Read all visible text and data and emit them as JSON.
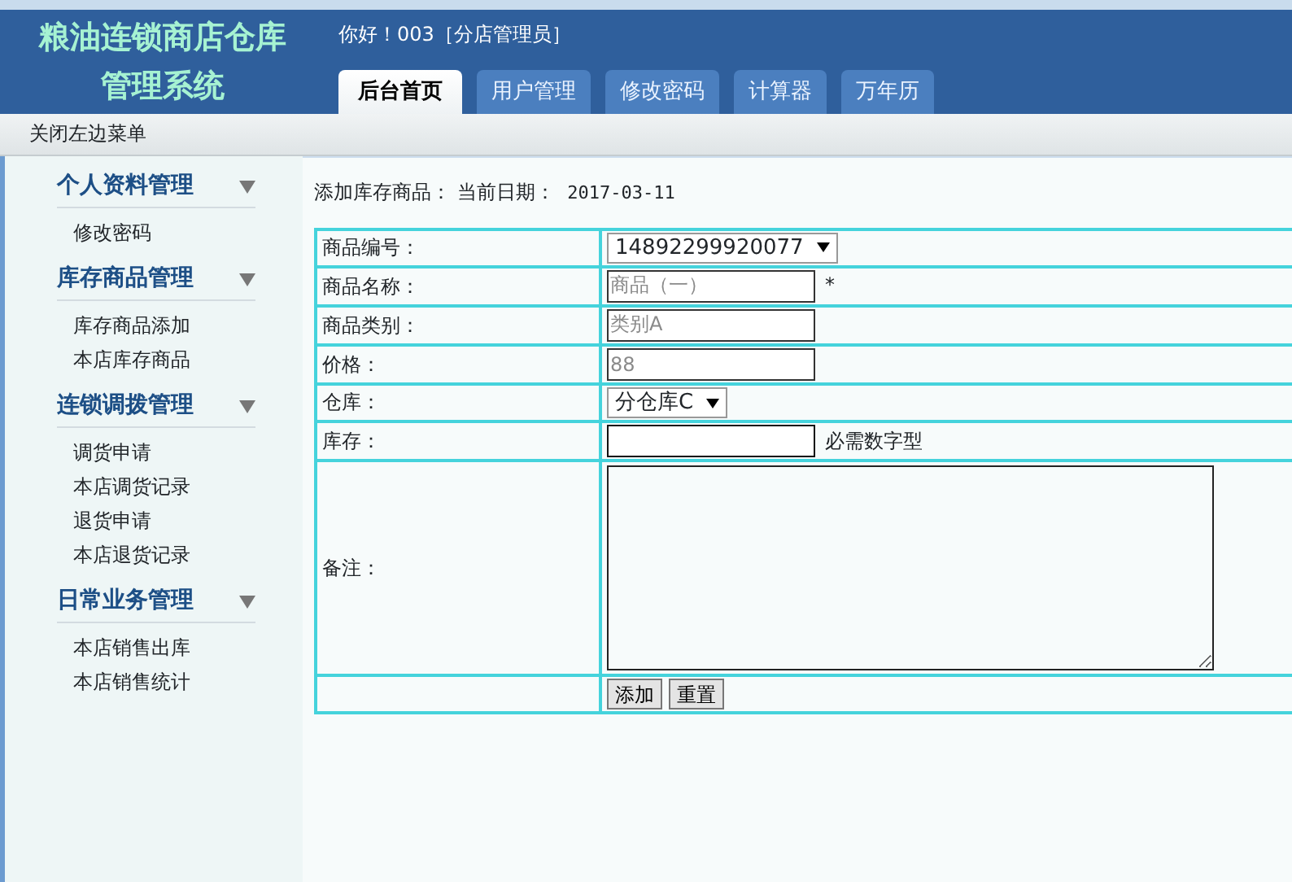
{
  "header": {
    "title_lines": [
      "粮油连锁商店仓库",
      "管理系统"
    ],
    "greeting": "你好！003［分店管理员］"
  },
  "tabs": [
    {
      "label": "后台首页",
      "selected": true
    },
    {
      "label": "用户管理",
      "selected": false
    },
    {
      "label": "修改密码",
      "selected": false
    },
    {
      "label": "计算器",
      "selected": false
    },
    {
      "label": "万年历",
      "selected": false
    }
  ],
  "toolbar": {
    "link": "关闭左边菜单"
  },
  "sidebar": {
    "groups": [
      {
        "title": "个人资料管理",
        "items": [
          "修改密码"
        ]
      },
      {
        "title": "库存商品管理",
        "items": [
          "库存商品添加",
          "本店库存商品"
        ]
      },
      {
        "title": "连锁调拨管理",
        "items": [
          "调货申请",
          "本店调货记录",
          "退货申请",
          "本店退货记录"
        ]
      },
      {
        "title": "日常业务管理",
        "items": [
          "本店销售出库",
          "本店销售统计"
        ]
      }
    ]
  },
  "content": {
    "heading": "添加库存商品：",
    "date_label": "当前日期：",
    "date": "2017-03-11",
    "form": [
      {
        "kind": "select",
        "label": "商品编号：",
        "value": "14892299920077"
      },
      {
        "kind": "text",
        "label": "商品名称：",
        "value": "商品（一）",
        "disabled": true,
        "note": "*"
      },
      {
        "kind": "text",
        "label": "商品类别：",
        "value": "类别A",
        "disabled": true
      },
      {
        "kind": "text",
        "label": "价格：",
        "value": "88",
        "disabled": true
      },
      {
        "kind": "select",
        "label": "仓库：",
        "value": "分仓库C"
      },
      {
        "kind": "text",
        "label": "库存：",
        "disabled": false,
        "note": "必需数字型"
      },
      {
        "kind": "textarea",
        "label": "备注："
      },
      {
        "kind": "buttons",
        "buttons": [
          "添加",
          "重置"
        ]
      }
    ]
  }
}
